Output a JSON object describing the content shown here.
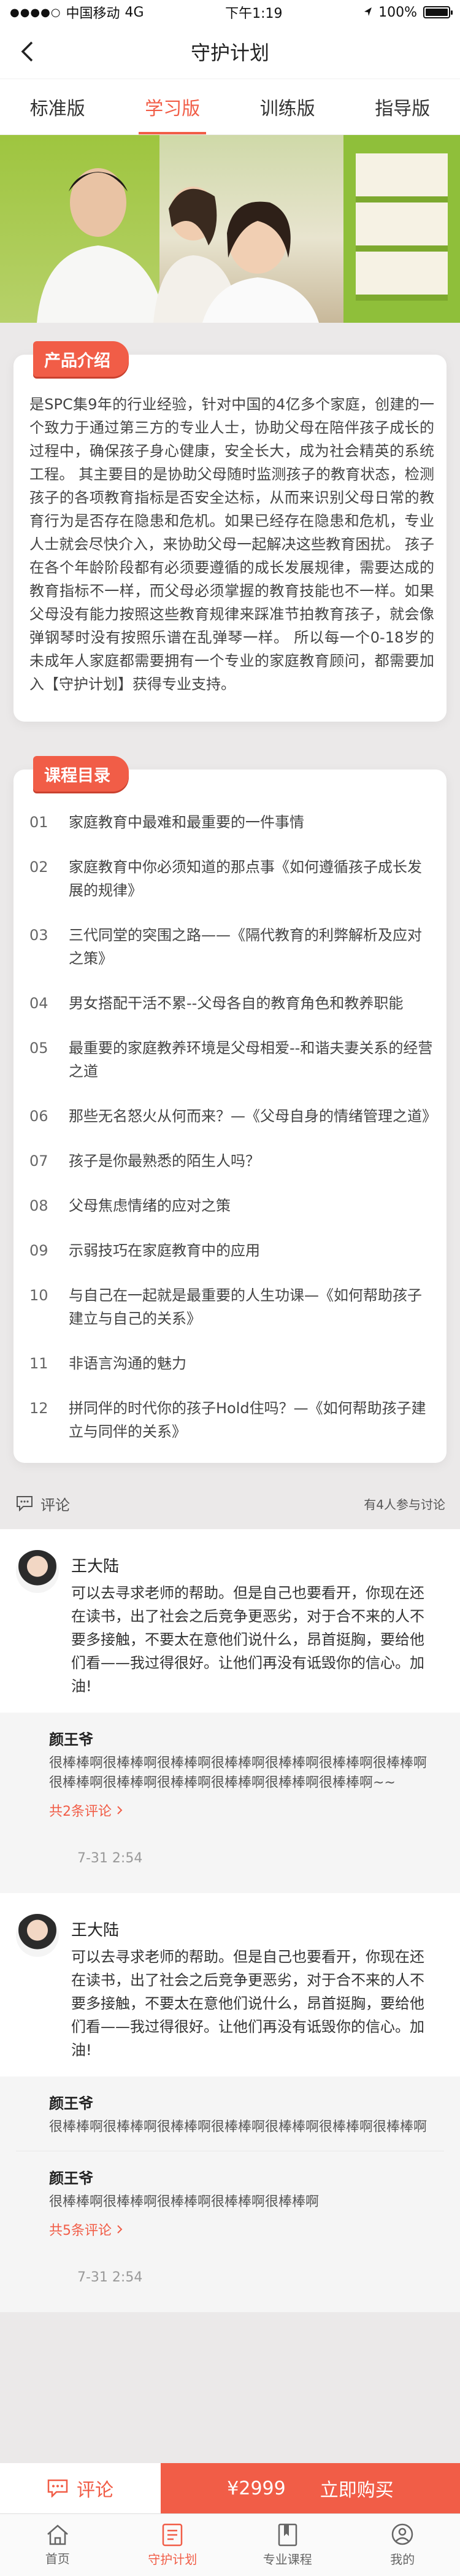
{
  "status_bar": {
    "carrier": "中国移动",
    "network": "4G",
    "time": "下午1:19",
    "battery": "100%"
  },
  "navbar": {
    "title": "守护计划"
  },
  "tabs": [
    {
      "label": "标准版",
      "active": false
    },
    {
      "label": "学习版",
      "active": true
    },
    {
      "label": "训练版",
      "active": false
    },
    {
      "label": "指导版",
      "active": false
    }
  ],
  "intro": {
    "badge": "产品介绍",
    "text": "是SPC集9年的行业经验，针对中国的4亿多个家庭，创建的一个致力于通过第三方的专业人士，协助父母在陪伴孩子成长的过程中，确保孩子身心健康，安全长大，成为社会精英的系统工程。 其主要目的是协助父母随时监测孩子的教育状态，检测孩子的各项教育指标是否安全达标，从而来识别父母日常的教育行为是否存在隐患和危机。如果已经存在隐患和危机，专业人士就会尽快介入，来协助父母一起解决这些教育困扰。 孩子在各个年龄阶段都有必须要遵循的成长发展规律，需要达成的教育指标不一样，而父母必须掌握的教育技能也不一样。如果父母没有能力按照这些教育规律来踩准节拍教育孩子，就会像弹钢琴时没有按照乐谱在乱弹琴一样。 所以每一个0-18岁的未成年人家庭都需要拥有一个专业的家庭教育顾问，都需要加入【守护计划】获得专业支持。"
  },
  "courses": {
    "badge": "课程目录",
    "items": [
      {
        "num": "01",
        "title": "家庭教育中最难和最重要的一件事情"
      },
      {
        "num": "02",
        "title": "家庭教育中你必须知道的那点事《如何遵循孩子成长发展的规律》"
      },
      {
        "num": "03",
        "title": "三代同堂的突围之路——《隔代教育的利弊解析及应对之策》"
      },
      {
        "num": "04",
        "title": "男女搭配干活不累--父母各自的教育角色和教养职能"
      },
      {
        "num": "05",
        "title": "最重要的家庭教养环境是父母相爱--和谐夫妻关系的经营之道"
      },
      {
        "num": "06",
        "title": "那些无名怒火从何而来？—《父母自身的情绪管理之道》"
      },
      {
        "num": "07",
        "title": "孩子是你最熟悉的陌生人吗？"
      },
      {
        "num": "08",
        "title": "父母焦虑情绪的应对之策"
      },
      {
        "num": "09",
        "title": "示弱技巧在家庭教育中的应用"
      },
      {
        "num": "10",
        "title": "与自己在一起就是最重要的人生功课—《如何帮助孩子建立与自己的关系》"
      },
      {
        "num": "11",
        "title": "非语言沟通的魅力"
      },
      {
        "num": "12",
        "title": "拼同伴的时代你的孩子Hold住吗？—《如何帮助孩子建立与同伴的关系》"
      }
    ]
  },
  "comments": {
    "header_label": "评论",
    "participants": "有4人参与讨论",
    "list": [
      {
        "name": "王大陆",
        "text": "可以去寻求老师的帮助。但是自己也要看开，你现在还在读书，出了社会之后竞争更恶劣，对于合不来的人不要多接触，不要太在意他们说什么，昂首挺胸，要给他们看——我过得很好。让他们再没有诋毁你的信心。加油!",
        "replies": [
          {
            "name": "颜王爷",
            "text": "很棒棒啊很棒棒啊很棒棒啊很棒棒啊很棒棒啊很棒棒啊很棒棒啊很棒棒啊很棒棒啊很棒棒啊很棒棒啊很棒棒啊很棒棒啊~~"
          }
        ],
        "more": "共2条评论",
        "time": "7-31  2:54"
      },
      {
        "name": "王大陆",
        "text": "可以去寻求老师的帮助。但是自己也要看开，你现在还在读书，出了社会之后竞争更恶劣，对于合不来的人不要多接触，不要太在意他们说什么，昂首挺胸，要给他们看——我过得很好。让他们再没有诋毁你的信心。加油!",
        "replies": [
          {
            "name": "颜王爷",
            "text": "很棒棒啊很棒棒啊很棒棒啊很棒棒啊很棒棒啊很棒棒啊很棒棒啊"
          },
          {
            "name": "颜王爷",
            "text": "很棒棒啊很棒棒啊很棒棒啊很棒棒啊很棒棒啊"
          }
        ],
        "more": "共5条评论",
        "time": "7-31  2:54"
      }
    ]
  },
  "buybar": {
    "comment_label": "评论",
    "price": "¥2999",
    "buy_label": "立即购买"
  },
  "tabbar": [
    {
      "label": "首页",
      "icon": "home-icon",
      "active": false
    },
    {
      "label": "守护计划",
      "icon": "plan-icon",
      "active": true
    },
    {
      "label": "专业课程",
      "icon": "book-icon",
      "active": false
    },
    {
      "label": "我的",
      "icon": "profile-icon",
      "active": false
    }
  ],
  "colors": {
    "accent": "#f15d47",
    "background": "#ebe9e9"
  }
}
